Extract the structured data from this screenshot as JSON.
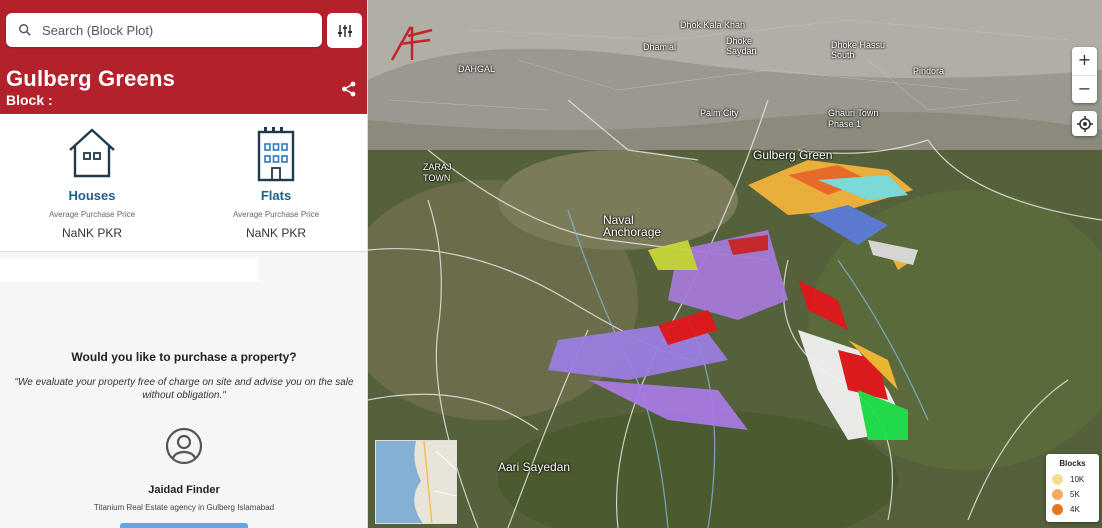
{
  "search": {
    "placeholder": "Search (Block Plot)"
  },
  "header": {
    "title": "Gulberg Greens",
    "block_label": "Block :"
  },
  "property_types": [
    {
      "name": "Houses",
      "subtitle": "Average Purchase Price",
      "price": "NaNK PKR",
      "icon": "house-icon"
    },
    {
      "name": "Flats",
      "subtitle": "Average Purchase Price",
      "price": "NaNK PKR",
      "icon": "building-icon"
    }
  ],
  "purchase": {
    "question": "Would you like to purchase a property?",
    "quote": "\"We evaluate your property free of charge on site and advise you on the sale without obligation.\""
  },
  "agent": {
    "name": "Jaidad Finder",
    "description": "Titanium Real Estate agency in Gulberg Islamabad"
  },
  "map": {
    "zoom_in": "+",
    "zoom_out": "−",
    "labels": [
      {
        "text": "Gulberg Green"
      },
      {
        "text": "Naval Anchorage"
      },
      {
        "text": "Aari Sayedan"
      },
      {
        "text": "ZARAJ TOWN"
      },
      {
        "text": "Palm City"
      },
      {
        "text": "Ghauri Town Phase 1"
      },
      {
        "text": "DAHGAL"
      },
      {
        "text": "Dhamial"
      },
      {
        "text": "Pindora"
      },
      {
        "text": "Dhoke Hassu South"
      },
      {
        "text": "Dhoke Saydan"
      },
      {
        "text": "Dhok Kala Khan"
      }
    ],
    "legend": {
      "title": "Blocks",
      "items": [
        {
          "label": "10K",
          "color": "#f9dc93"
        },
        {
          "label": "5K",
          "color": "#f4ac5e"
        },
        {
          "label": "4K",
          "color": "#e5761c"
        }
      ]
    }
  },
  "colors": {
    "brand": "#b3212b",
    "accent": "#1d5f8d"
  }
}
